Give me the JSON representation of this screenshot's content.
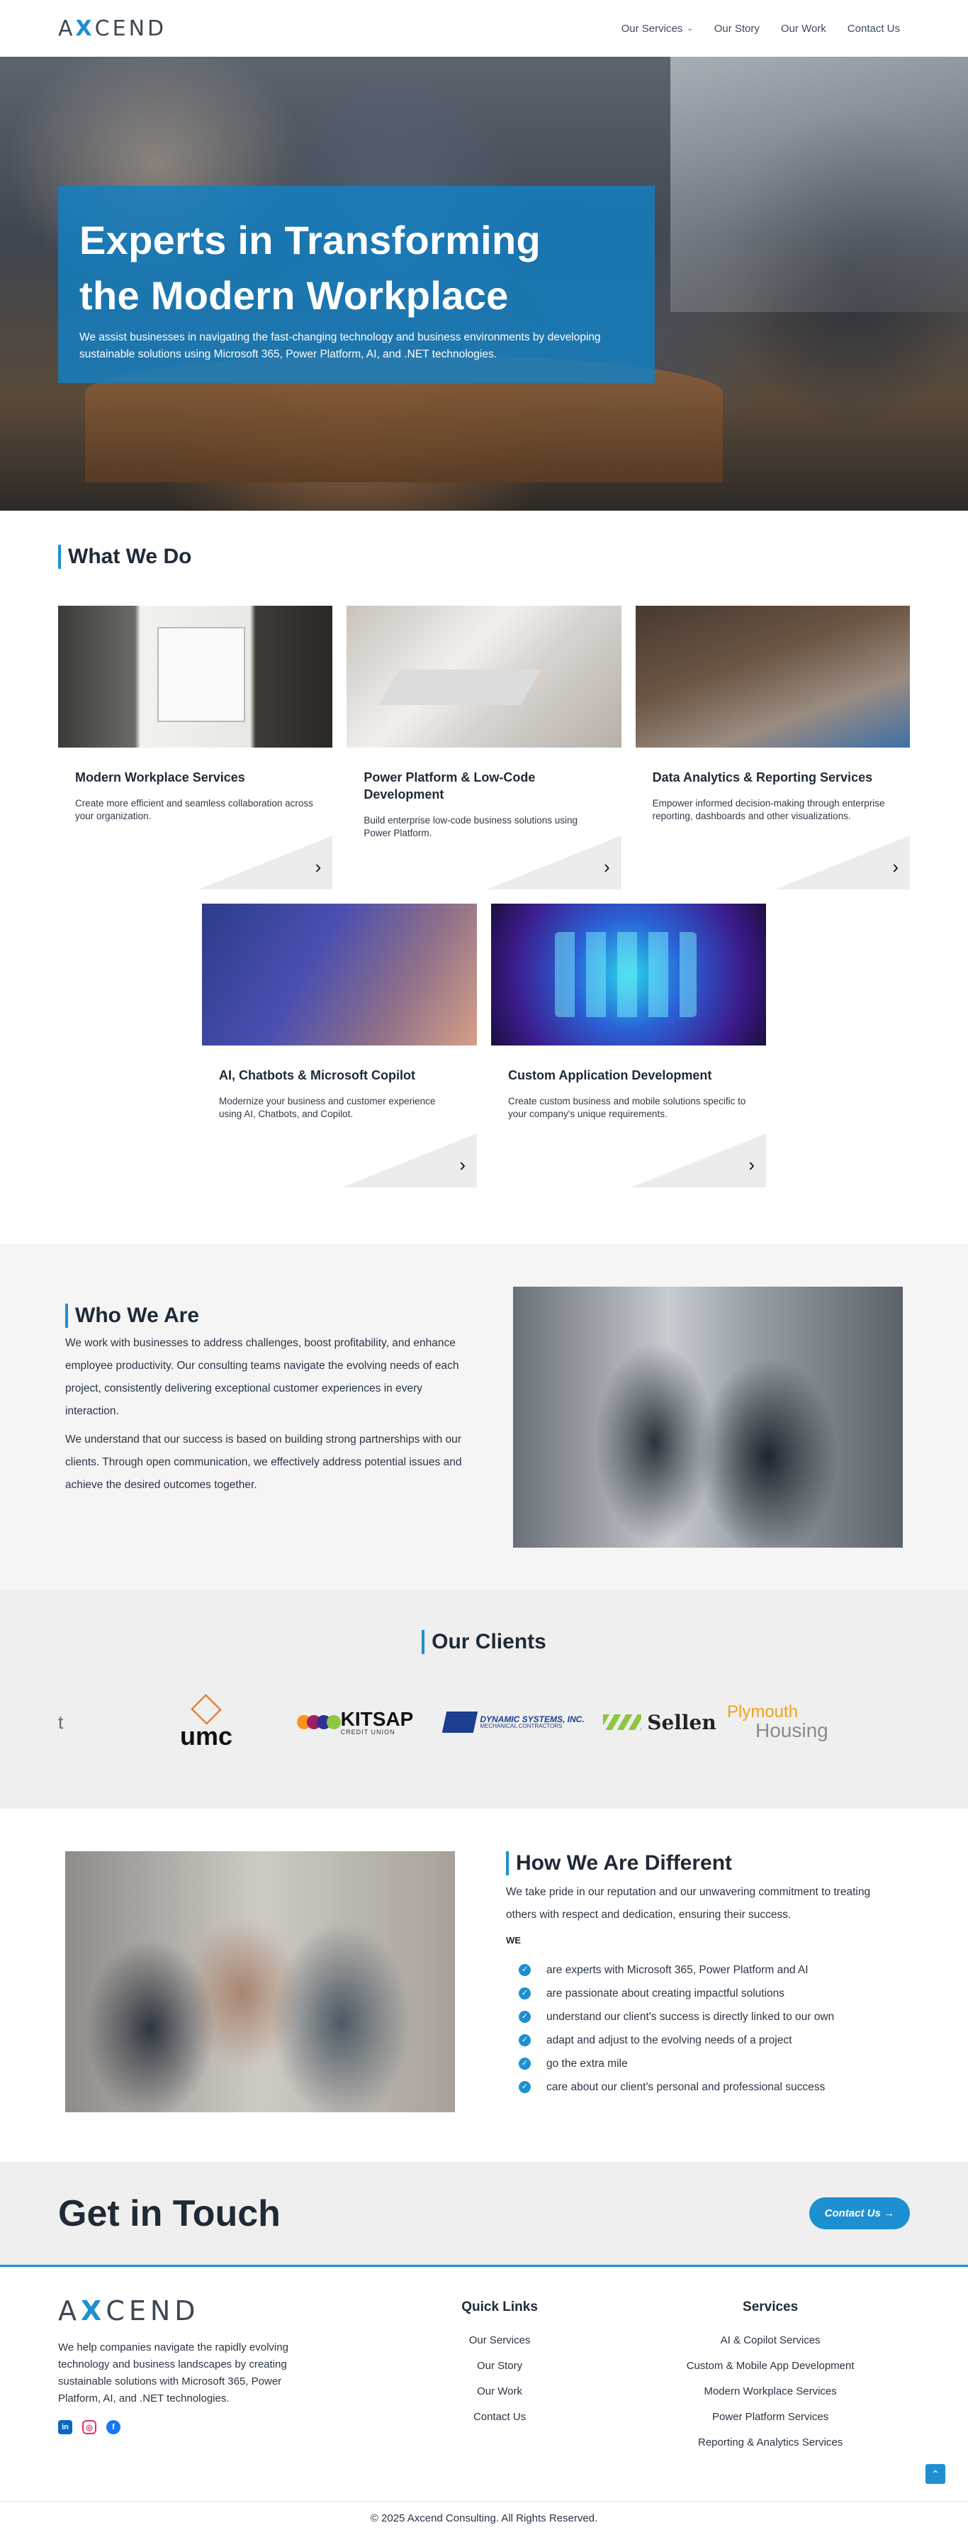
{
  "header": {
    "logo": {
      "pre": "A",
      "x": "X",
      "post": "CEND"
    },
    "nav": [
      "Our Services",
      "Our Story",
      "Our Work",
      "Contact Us"
    ]
  },
  "hero": {
    "title_line1": "Experts in Transforming",
    "title_line2": "the Modern Workplace",
    "text": "We assist businesses in navigating the fast-changing technology and business environments by developing sustainable solutions using Microsoft 365, Power Platform, AI, and .NET technologies."
  },
  "what": {
    "title": "What We Do",
    "cards": [
      {
        "title": "Modern Workplace Services",
        "desc": "Create more efficient and seamless collaboration across your organization."
      },
      {
        "title": "Power Platform & Low-Code Development",
        "desc": "Build enterprise low-code business solutions using Power Platform."
      },
      {
        "title": "Data Analytics & Reporting Services",
        "desc": "Empower informed decision-making through enterprise reporting, dashboards and other visualizations."
      },
      {
        "title": "AI, Chatbots & Microsoft Copilot",
        "desc": "Modernize your business and customer experience using AI, Chatbots, and Copilot."
      },
      {
        "title": "Custom Application Development",
        "desc": "Create custom business and mobile solutions specific to your company's unique requirements."
      }
    ]
  },
  "who": {
    "title": "Who We Are",
    "p1": "We work with businesses to address challenges, boost profitability, and enhance employee productivity. Our consulting teams navigate the evolving needs of each project, consistently delivering exceptional customer experiences in every interaction.",
    "p2": "We understand that our success is based on building strong partnerships with our clients. Through open communication, we effectively address potential issues and achieve the desired outcomes together."
  },
  "clients": {
    "title": "Our Clients",
    "logos": {
      "partial": "t",
      "umc": "umc",
      "kitsap": "KITSAP",
      "kitsap_sub": "CREDIT UNION",
      "dynamic": "DYNAMIC SYSTEMS, INC.",
      "dynamic_sub": "MECHANICAL CONTRACTORS",
      "sellen": "Sellen",
      "plymouth_a": "Plymouth",
      "plymouth_b": "Housing"
    }
  },
  "diff": {
    "title": "How We Are Different",
    "lead": "We take pride in our reputation and our unwavering commitment to treating others with respect and dedication, ensuring their success.",
    "we": "WE",
    "items": [
      "are experts with Microsoft 365, Power Platform and AI",
      "are passionate about creating impactful solutions",
      "understand our client's success is directly linked to our own",
      "adapt and adjust to the evolving needs of a project",
      "go the extra mile",
      "care about our client's personal and professional success"
    ]
  },
  "contact": {
    "title": "Get in Touch",
    "button": "Contact Us →"
  },
  "footer": {
    "logo": {
      "pre": "A",
      "x": "X",
      "post": "CEND"
    },
    "desc": "We help companies navigate the rapidly evolving technology and business landscapes by creating sustainable solutions with Microsoft 365, Power Platform, AI, and .NET technologies.",
    "quick_title": "Quick Links",
    "quick_links": [
      "Our Services",
      "Our Story",
      "Our Work",
      "Contact Us"
    ],
    "services_title": "Services",
    "services": [
      "AI & Copilot Services",
      "Custom & Mobile App Development",
      "Modern Workplace Services",
      "Power Platform Services",
      "Reporting & Analytics Services"
    ],
    "copyright": "© 2025 Axcend Consulting. All Rights Reserved."
  },
  "colors": {
    "accent": "#1e8fd0",
    "dark": "#1f2a37",
    "band": "#efefef"
  }
}
